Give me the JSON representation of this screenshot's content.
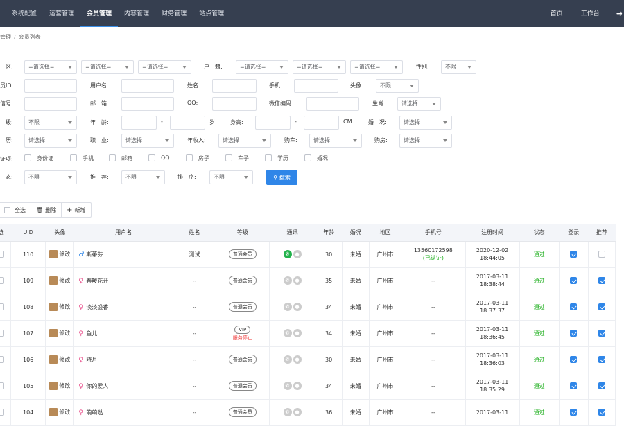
{
  "topnav": {
    "items": [
      "系统配置",
      "运营管理",
      "会员管理",
      "内容管理",
      "财务管理",
      "站点管理"
    ],
    "right": [
      "首页",
      "工作台"
    ]
  },
  "breadcrumb": {
    "parent": "管理",
    "current": "会员列表"
  },
  "filters": {
    "region_label": "区:",
    "hukou_label": "户　籍:",
    "gender_label": "性别:",
    "placeholder_select": "=请选择=",
    "not_limit": "不限",
    "please_select": "请选择",
    "uid_label": "员ID:",
    "username_label": "用户名:",
    "name_label": "姓名:",
    "phone_label": "手机:",
    "avatar_label": "头像:",
    "email_label": "信号:",
    "mailbox_label": "邮　箱:",
    "qq_label": "QQ:",
    "wechat_label": "微信编码:",
    "zodiac_label": "生肖:",
    "grade_label": "级:",
    "age_label": "年　龄:",
    "age_sep": "-",
    "age_unit": "岁",
    "height_label": "身高:",
    "height_sep": "-",
    "height_unit": "CM",
    "marriage_label": "婚　况:",
    "edu_label": "历:",
    "job_label": "职　业:",
    "income_label": "年收入:",
    "car_label": "购车:",
    "house_label": "购房:",
    "cert_label": "证项:",
    "certs": [
      "身份证",
      "手机",
      "邮箱",
      "QQ",
      "房子",
      "车子",
      "学历",
      "婚况"
    ],
    "status_label": "态:",
    "recommend_label": "推　荐:",
    "sort_label": "排　序:",
    "search_button": "搜索"
  },
  "toolbar": {
    "select_all": "全选",
    "delete": "删除",
    "add": "新增"
  },
  "table": {
    "headers": [
      "选",
      "UID",
      "头像",
      "用户名",
      "姓名",
      "等级",
      "通讯",
      "年龄",
      "婚况",
      "地区",
      "手机号",
      "注册时间",
      "状态",
      "登录",
      "推荐"
    ],
    "edit_label": "修改",
    "rows": [
      {
        "uid": "110",
        "username": "斯蒂芬",
        "gender": "m",
        "name": "测试",
        "level": "普通会员",
        "stop": "",
        "wechat": true,
        "age": "30",
        "marriage": "未婚",
        "region": "广州市",
        "phone": "13560172598",
        "phone_verified": "(已认证)",
        "reg_date": "2020-12-02",
        "reg_time": "18:44:05",
        "status": "通过",
        "login": true,
        "rec": false
      },
      {
        "uid": "109",
        "username": "春暖花开",
        "gender": "f",
        "name": "--",
        "level": "普通会员",
        "stop": "",
        "wechat": false,
        "age": "35",
        "marriage": "未婚",
        "region": "广州市",
        "phone": "--",
        "phone_verified": "",
        "reg_date": "2017-03-11",
        "reg_time": "18:38:44",
        "status": "通过",
        "login": true,
        "rec": true
      },
      {
        "uid": "108",
        "username": "淡淡盛香",
        "gender": "f",
        "name": "--",
        "level": "普通会员",
        "stop": "",
        "wechat": false,
        "age": "34",
        "marriage": "未婚",
        "region": "广州市",
        "phone": "--",
        "phone_verified": "",
        "reg_date": "2017-03-11",
        "reg_time": "18:37:37",
        "status": "通过",
        "login": true,
        "rec": true
      },
      {
        "uid": "107",
        "username": "鱼儿",
        "gender": "f",
        "name": "--",
        "level": "VIP",
        "stop": "服务停止",
        "wechat": false,
        "age": "34",
        "marriage": "未婚",
        "region": "广州市",
        "phone": "--",
        "phone_verified": "",
        "reg_date": "2017-03-11",
        "reg_time": "18:36:45",
        "status": "通过",
        "login": true,
        "rec": true
      },
      {
        "uid": "106",
        "username": "晓月",
        "gender": "f",
        "name": "--",
        "level": "普通会员",
        "stop": "",
        "wechat": false,
        "age": "30",
        "marriage": "未婚",
        "region": "广州市",
        "phone": "--",
        "phone_verified": "",
        "reg_date": "2017-03-11",
        "reg_time": "18:36:03",
        "status": "通过",
        "login": true,
        "rec": true
      },
      {
        "uid": "105",
        "username": "你的爱人",
        "gender": "f",
        "name": "--",
        "level": "普通会员",
        "stop": "",
        "wechat": false,
        "age": "34",
        "marriage": "未婚",
        "region": "广州市",
        "phone": "--",
        "phone_verified": "",
        "reg_date": "2017-03-11",
        "reg_time": "18:35:29",
        "status": "通过",
        "login": true,
        "rec": true
      },
      {
        "uid": "104",
        "username": "萌萌哒",
        "gender": "f",
        "name": "--",
        "level": "普通会员",
        "stop": "",
        "wechat": false,
        "age": "36",
        "marriage": "未婚",
        "region": "广州市",
        "phone": "--",
        "phone_verified": "",
        "reg_date": "2017-03-11",
        "reg_time": "",
        "status": "通过",
        "login": true,
        "rec": true
      }
    ]
  },
  "colors": {
    "topbar": "#363f50",
    "accent": "#2f86e8",
    "success": "#1aad19",
    "danger": "#e33333"
  }
}
